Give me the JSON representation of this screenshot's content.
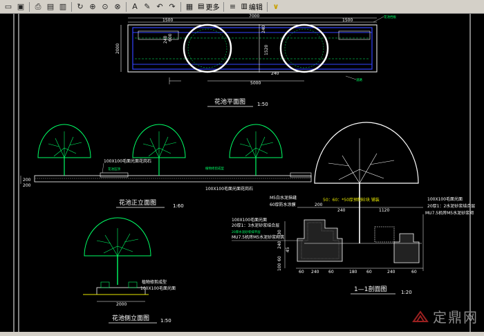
{
  "toolbar": {
    "more_label": "更多",
    "edit_label": "编辑",
    "icons": [
      "open-icon",
      "save-icon",
      "print-icon",
      "print-preview-icon",
      "export-icon",
      "rotate-icon",
      "zoom-realtime-icon",
      "zoom-window-icon",
      "zoom-fit-icon",
      "text-icon",
      "pen-icon",
      "undo-icon",
      "redo-icon",
      "color-icon",
      "more-icon",
      "layer-icon",
      "edit-icon",
      "check-icon"
    ]
  },
  "drawing": {
    "plan": {
      "title": "花池平面图",
      "scale": "1:50",
      "dims": {
        "total": "7000",
        "left": "1500",
        "right": "1500",
        "bottom": "5000",
        "height": "2000",
        "side1": "240",
        "side2": "240",
        "sub1": "600",
        "sub2": "1520",
        "sub3": "240",
        "sub4": "600"
      },
      "notes": [
        "花池挡板",
        "道路"
      ]
    },
    "front": {
      "title": "花池正立面图",
      "scale": "1:60",
      "labels": [
        "100X100毛面光面花岗石",
        "花池压顶",
        "100X100毛面光面花岗石",
        "植物修剪成型"
      ],
      "dims": [
        "200",
        "200"
      ]
    },
    "side": {
      "title": "花池侧立面图",
      "scale": "1:50",
      "labels": [
        "植物修剪成型",
        "100X100毛面光面"
      ],
      "dims": [
        "2000"
      ]
    },
    "section": {
      "title": "1—1剖面图",
      "scale": "1:20",
      "labels_left": [
        "M5白水泥抹缝",
        "60厚防水涂膜",
        "100X100毛面光面",
        "20厚1：3水泥砂浆结合层",
        "20厚水泥砂浆抹平层",
        "MU7.5机砖M5水泥砂浆砌筑"
      ],
      "labels_right": [
        "100X100毛面光面",
        "20厚1：2水泥砂浆结合层",
        "MU7.5机砖M5水泥砂浆砌"
      ],
      "top_note": "50：60：*50厚预制砼块 铺装",
      "dims_top": [
        "200",
        "240",
        "1120"
      ],
      "dims_left": [
        "30",
        "240",
        "45",
        "60",
        "100"
      ],
      "dims_bottom": [
        "60",
        "240",
        "60",
        "180",
        "60",
        "240",
        "60"
      ]
    }
  },
  "watermark": "定鼎网"
}
